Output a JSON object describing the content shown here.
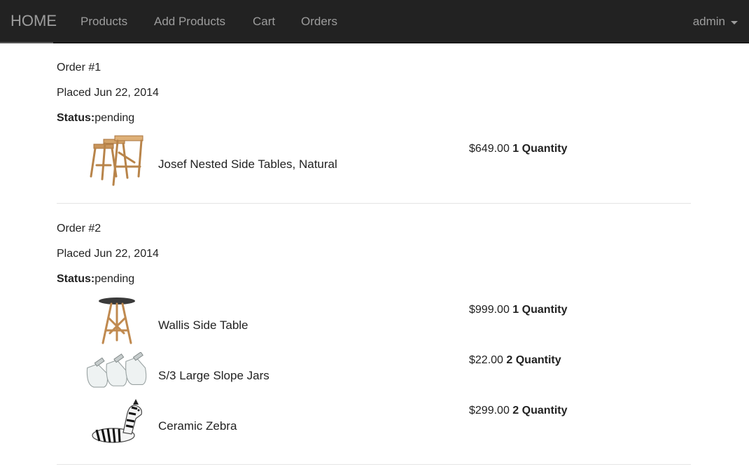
{
  "nav": {
    "brand": "HOME",
    "links": [
      "Products",
      "Add Products",
      "Cart",
      "Orders"
    ],
    "user": "admin"
  },
  "orders": [
    {
      "title": "Order #1",
      "placed": "Placed Jun 22, 2014",
      "status_label": "Status:",
      "status": "pending",
      "items": [
        {
          "name": "Josef Nested Side Tables, Natural",
          "price": "$649.00",
          "qty": "1 Quantity",
          "icon": "nested-tables-icon"
        }
      ]
    },
    {
      "title": "Order #2",
      "placed": "Placed Jun 22, 2014",
      "status_label": "Status:",
      "status": "pending",
      "items": [
        {
          "name": "Wallis Side Table",
          "price": "$999.00",
          "qty": "1 Quantity",
          "icon": "side-table-icon"
        },
        {
          "name": "S/3 Large Slope Jars",
          "price": "$22.00",
          "qty": "2 Quantity",
          "icon": "jars-icon"
        },
        {
          "name": "Ceramic Zebra",
          "price": "$299.00",
          "qty": "2 Quantity",
          "icon": "zebra-icon"
        }
      ]
    }
  ]
}
